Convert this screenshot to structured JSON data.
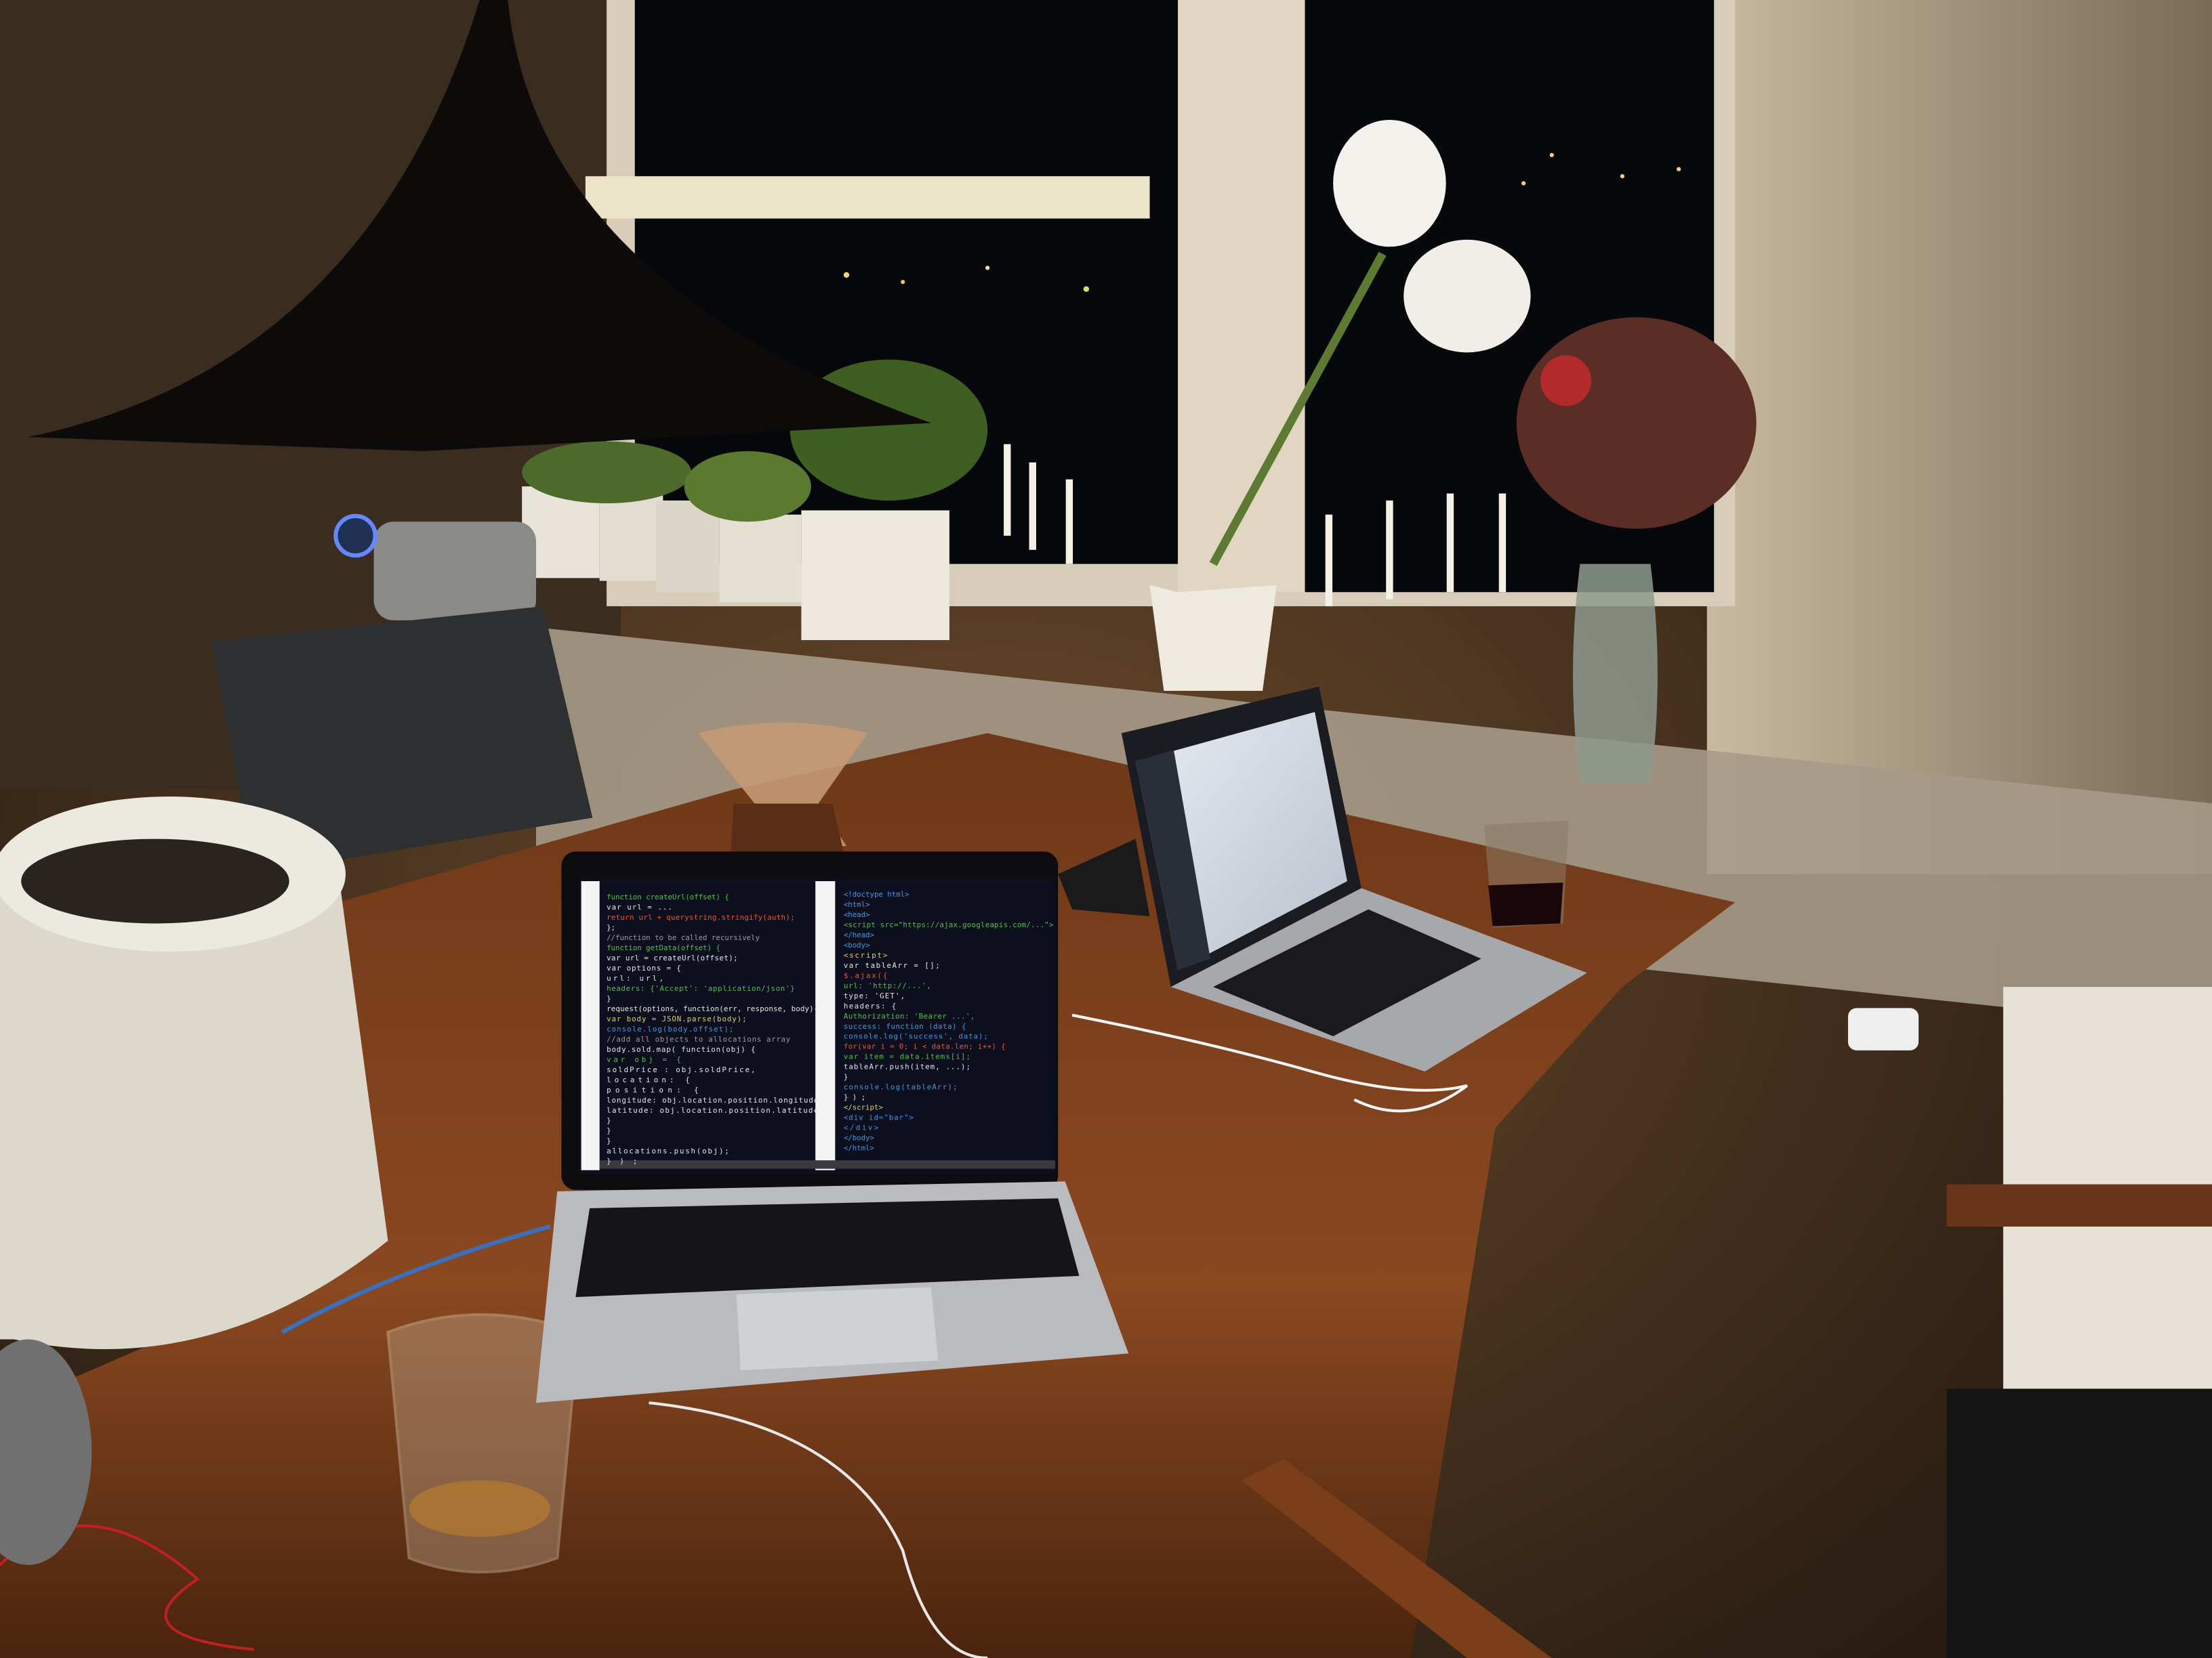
{
  "scene": {
    "description_label": "Laptops on a wooden table at night"
  },
  "left_laptop": {
    "editor_left_pane": [
      {
        "text": "function createUrl(offset) {",
        "color": "#4fc24a"
      },
      {
        "text": "  var url = ...",
        "color": "#e6e6e6"
      },
      {
        "text": "  return url + querystring.stringify(auth);",
        "color": "#e05a3c"
      },
      {
        "text": "};",
        "color": "#e6e6e6"
      },
      {
        "text": "//function to be called recursively",
        "color": "#9a9a9a"
      },
      {
        "text": "function getData(offset) {",
        "color": "#4fc24a"
      },
      {
        "text": "  var url = createUrl(offset);",
        "color": "#e6e6e6"
      },
      {
        "text": "  var options = {",
        "color": "#e6e6e6"
      },
      {
        "text": "    url: url,",
        "color": "#e6e6e6"
      },
      {
        "text": "    headers: {'Accept': 'application/json'}",
        "color": "#4fc24a"
      },
      {
        "text": "  }",
        "color": "#e6e6e6"
      },
      {
        "text": "  request(options, function(err, response, body){",
        "color": "#e6e6e6"
      },
      {
        "text": "    var body = JSON.parse(body);",
        "color": "#d8d27a"
      },
      {
        "text": "    console.log(body.offset);",
        "color": "#3d9be0"
      },
      {
        "text": "    //add all objects to allocations array",
        "color": "#9a9a9a"
      },
      {
        "text": "    body.sold.map( function(obj) {",
        "color": "#e6e6e6"
      },
      {
        "text": "      var obj = {",
        "color": "#4fc24a"
      },
      {
        "text": "        soldPrice : obj.soldPrice,",
        "color": "#e6e6e6"
      },
      {
        "text": "        location: {",
        "color": "#e6e6e6"
      },
      {
        "text": "          position: {",
        "color": "#e6e6e6"
      },
      {
        "text": "            longitude: obj.location.position.longitude",
        "color": "#e6e6e6"
      },
      {
        "text": "            latitude: obj.location.position.latitude",
        "color": "#e6e6e6"
      },
      {
        "text": "          }",
        "color": "#e6e6e6"
      },
      {
        "text": "        }",
        "color": "#e6e6e6"
      },
      {
        "text": "      }",
        "color": "#e6e6e6"
      },
      {
        "text": "      allocations.push(obj);",
        "color": "#e6e6e6"
      },
      {
        "text": "    });",
        "color": "#e6e6e6"
      }
    ],
    "editor_right_pane": [
      {
        "text": "<!doctype html>",
        "color": "#3d9be0"
      },
      {
        "text": "<html>",
        "color": "#3d9be0"
      },
      {
        "text": "<head>",
        "color": "#3d9be0"
      },
      {
        "text": "  <script src=\"https://ajax.googleapis.com/...\">",
        "color": "#4fc24a"
      },
      {
        "text": "</head>",
        "color": "#3d9be0"
      },
      {
        "text": "<body>",
        "color": "#3d9be0"
      },
      {
        "text": "  <script>",
        "color": "#d8d27a"
      },
      {
        "text": "    var tableArr = [];",
        "color": "#e6e6e6"
      },
      {
        "text": "  $.ajax({",
        "color": "#e05a3c"
      },
      {
        "text": "  url: 'http://...',",
        "color": "#4fc24a"
      },
      {
        "text": "  type: 'GET',",
        "color": "#e6e6e6"
      },
      {
        "text": "  headers: {",
        "color": "#e6e6e6"
      },
      {
        "text": "  Authorization: 'Bearer ...',",
        "color": "#4fc24a"
      },
      {
        "text": "  success: function (data) {",
        "color": "#3d9be0"
      },
      {
        "text": "    console.log('success', data);",
        "color": "#3d9be0"
      },
      {
        "text": "  for(var i = 0; i < data.len; i++) {",
        "color": "#e05a3c"
      },
      {
        "text": "    var item = data.items[i];",
        "color": "#4fc24a"
      },
      {
        "text": "    tableArr.push(item, ...);",
        "color": "#e6e6e6"
      },
      {
        "text": "  }",
        "color": "#e6e6e6"
      },
      {
        "text": "    console.log(tableArr);",
        "color": "#3d9be0"
      },
      {
        "text": "  });",
        "color": "#e6e6e6"
      },
      {
        "text": "</script>",
        "color": "#d8d27a"
      },
      {
        "text": "  <div id=\"bar\">",
        "color": "#3d9be0"
      },
      {
        "text": "  </div>",
        "color": "#3d9be0"
      },
      {
        "text": "</body>",
        "color": "#3d9be0"
      },
      {
        "text": "</html>",
        "color": "#3d9be0"
      }
    ]
  },
  "colors": {
    "wall": "#2a1f16",
    "table": "#7a3f1c",
    "night": "#05070a",
    "editor_bg": "#0d0f1e"
  }
}
